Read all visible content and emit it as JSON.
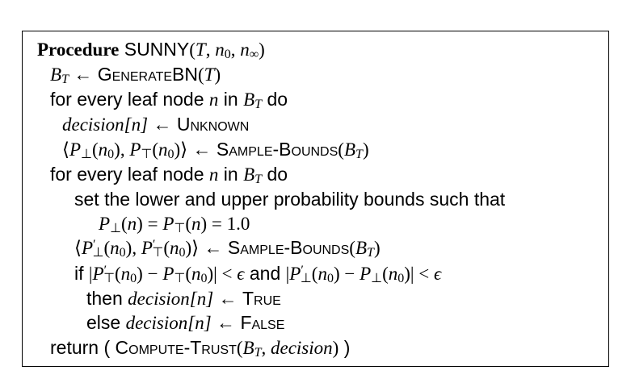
{
  "procedure": {
    "keyword": "Procedure",
    "name": "SUNNY",
    "signature": "(T, n0, n∞)"
  },
  "lines": {
    "l2": {
      "lhs": "B",
      "lhs_sub": "T",
      "arrow": "←",
      "func": "GenerateBN",
      "arg": "(T)"
    },
    "l3": {
      "text_a": "for every leaf node ",
      "var": "n",
      "text_b": " in ",
      "set": "B",
      "set_sub": "T",
      "text_c": " do"
    },
    "l4": {
      "lhs": "decision[n]",
      "arrow": "←",
      "value": "Unknown"
    },
    "l5": {
      "lhs": "⟨P⊥(n0), P⊤(n0)⟩",
      "arrow": "←",
      "func": "Sample-Bounds",
      "arg": "(BT)"
    },
    "l6": {
      "text_a": "for every leaf node ",
      "var": "n",
      "text_b": " in ",
      "set": "B",
      "set_sub": "T",
      "text_c": " do"
    },
    "l7": {
      "text": "set the lower and upper probability bounds such that"
    },
    "l8": {
      "expr": "P⊥(n) = P⊤(n) = 1.0"
    },
    "l9": {
      "lhs": "⟨P′⊥(n0), P′⊤(n0)⟩",
      "arrow": "←",
      "func": "Sample-Bounds",
      "arg": "(BT)"
    },
    "l10": {
      "kw_if": "if ",
      "cond_a": "|P′⊤(n0) − P⊤(n0)| < ϵ",
      "kw_and": " and ",
      "cond_b": "|P′⊥(n0) − P⊥(n0)| < ϵ"
    },
    "l11": {
      "kw": "then ",
      "lhs": "decision[n]",
      "arrow": "←",
      "value": "True"
    },
    "l12": {
      "kw": "else ",
      "lhs": "decision[n]",
      "arrow": "←",
      "value": "False"
    },
    "l13": {
      "kw": "return ( ",
      "func": "Compute-Trust",
      "arg": "(BT, decision)",
      "close": " )"
    }
  }
}
